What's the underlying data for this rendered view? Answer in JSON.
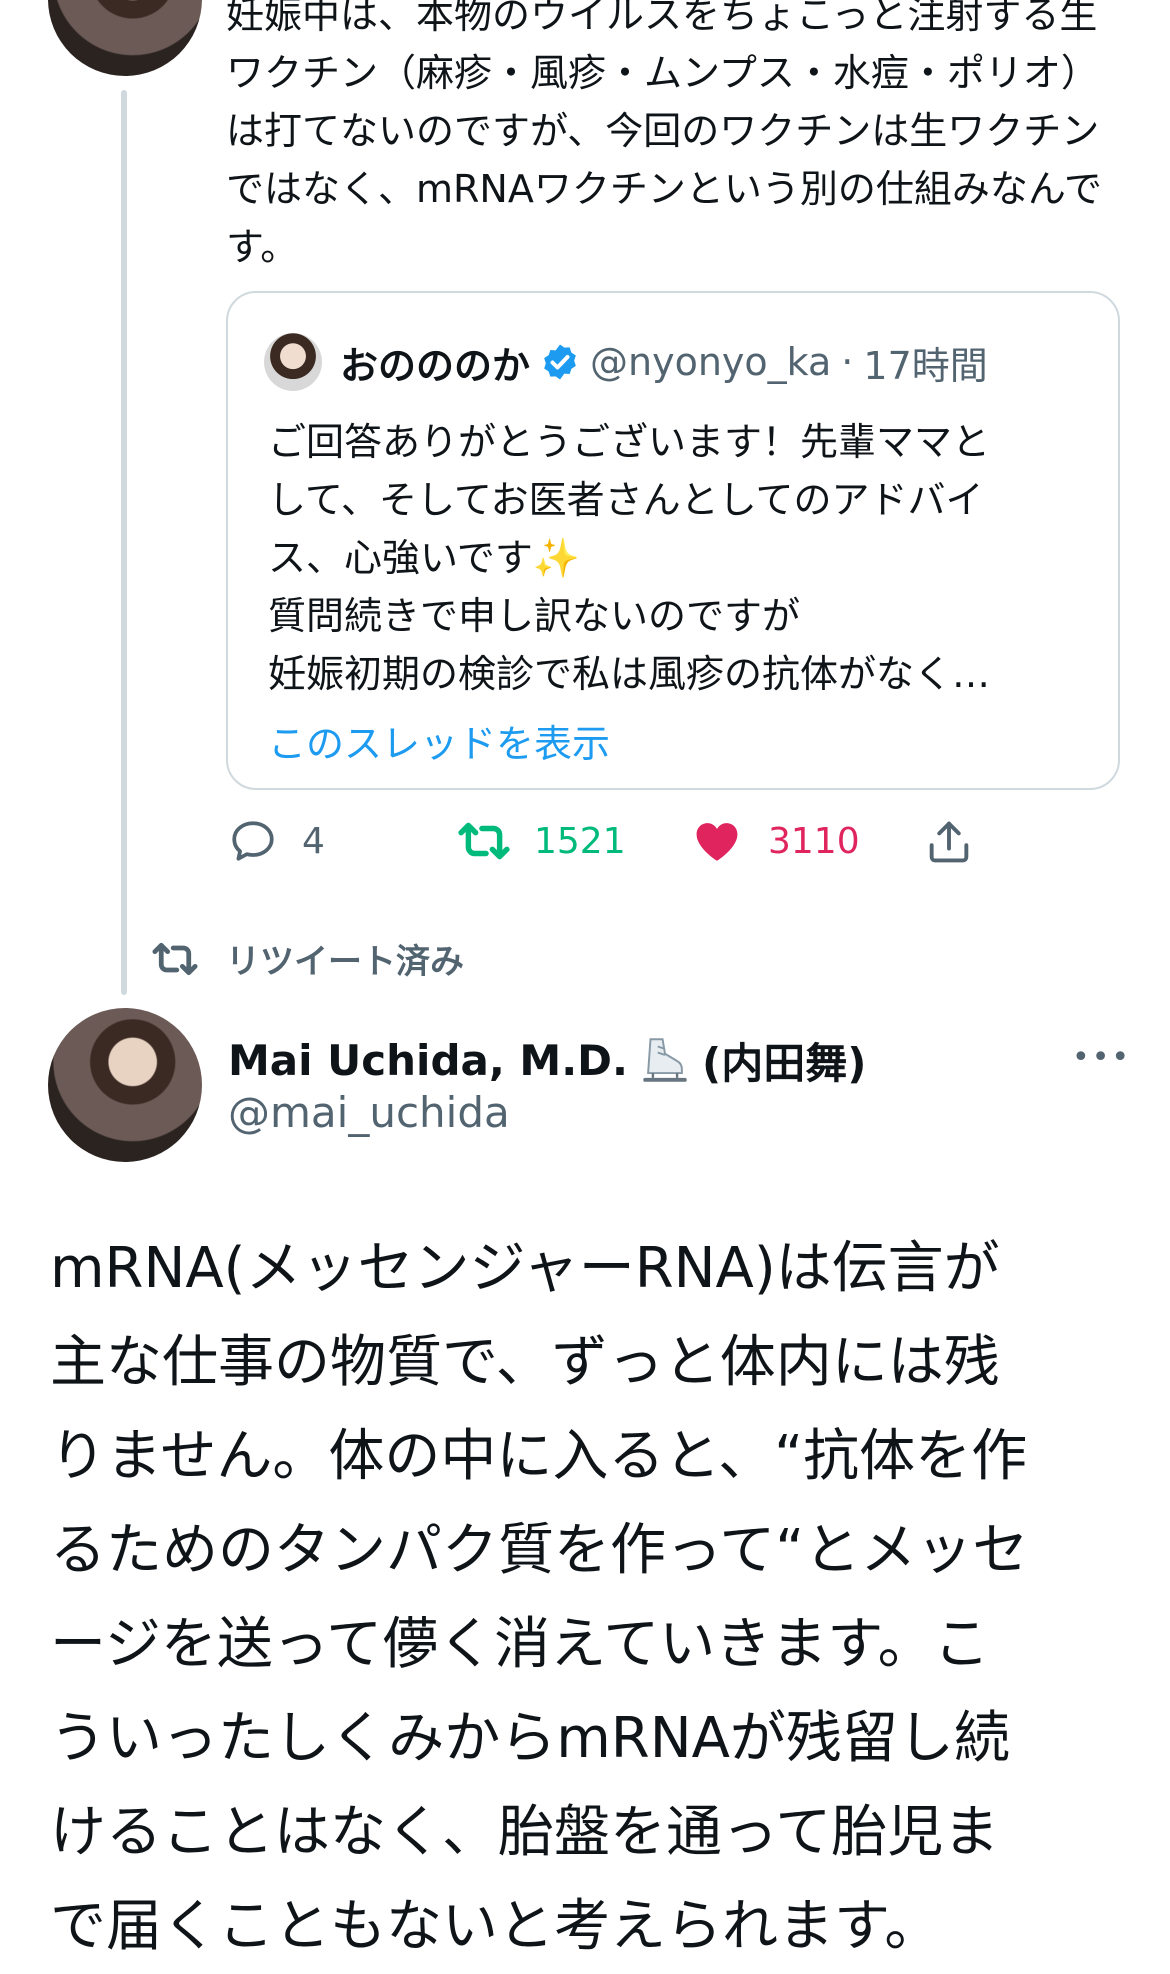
{
  "previous_tweet": {
    "text": "妊娠中は、本物のウイルスをちょこっと注射する生ワクチン（麻疹・風疹・ムンプス・水痘・ポリオ）は打てないのですが、今回のワクチンは生ワクチンではなく、mRNAワクチンという別の仕組みなんです。",
    "quoted": {
      "display_name": "おのののか",
      "handle": "@nyonyo_ka",
      "separator": "·",
      "time": "17時間",
      "text_lines": [
        "ご回答ありがとうございます！先輩ママと",
        "して、そしてお医者さんとしてのアドバイ",
        "ス、心強いです✨",
        "質問続きで申し訳ないのですが",
        "妊娠初期の検診で私は風疹の抗体がなく…"
      ],
      "show_thread": "このスレッドを表示"
    },
    "actions": {
      "reply_count": "4",
      "retweet_count": "1521",
      "like_count": "3110"
    }
  },
  "retweeted_label": "リツイート済み",
  "main_tweet": {
    "display_name": "Mai Uchida, M.D.",
    "name_suffix": "(内田舞)",
    "handle": "@mai_uchida",
    "more": "•••",
    "text_lines": [
      "mRNA(メッセンジャーRNA)は伝言が",
      "主な仕事の物質で、ずっと体内には残",
      "りません。体の中に入ると、“抗体を作",
      "るためのタンパク質を作って“とメッセ",
      "ージを送って儚く消えていきます。こ",
      "ういったしくみからmRNAが残留し続",
      "けることはなく、胎盤を通って胎児ま",
      "で届くこともないと考えられます。"
    ]
  },
  "colors": {
    "text": "#0f1419",
    "secondary": "#536471",
    "link": "#1d9bf0",
    "retweet_green": "#00ba7c",
    "like_red": "#f91880",
    "border": "#cfd9de"
  }
}
